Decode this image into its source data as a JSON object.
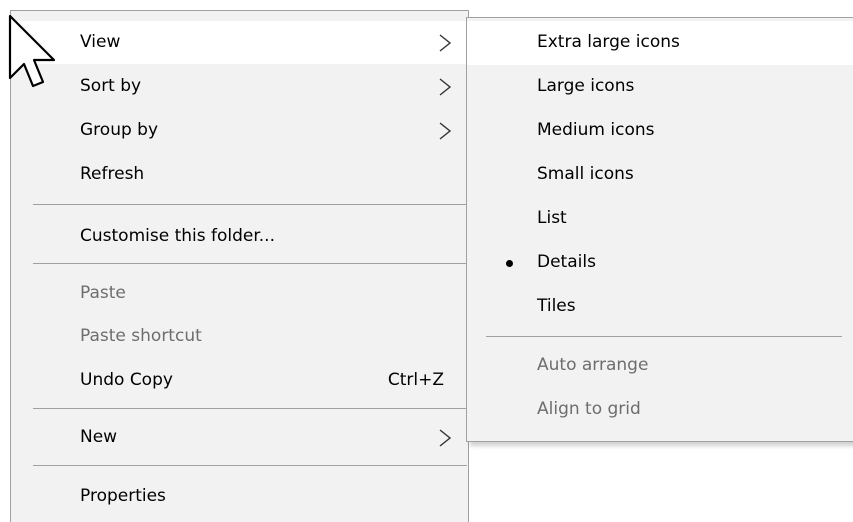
{
  "context_menu": {
    "items": [
      {
        "label": "View",
        "has_submenu": true,
        "highlighted": true
      },
      {
        "label": "Sort by",
        "has_submenu": true
      },
      {
        "label": "Group by",
        "has_submenu": true
      },
      {
        "label": "Refresh"
      },
      {
        "label": "Customise this folder..."
      },
      {
        "label": "Paste",
        "disabled": true
      },
      {
        "label": "Paste shortcut",
        "disabled": true
      },
      {
        "label": "Undo Copy",
        "shortcut": "Ctrl+Z"
      },
      {
        "label": "New",
        "has_submenu": true
      },
      {
        "label": "Properties"
      }
    ]
  },
  "view_submenu": {
    "items": [
      {
        "label": "Extra large icons",
        "highlighted": true
      },
      {
        "label": "Large icons"
      },
      {
        "label": "Medium icons"
      },
      {
        "label": "Small icons"
      },
      {
        "label": "List"
      },
      {
        "label": "Details",
        "selected": true
      },
      {
        "label": "Tiles"
      },
      {
        "label": "Auto arrange",
        "disabled": true
      },
      {
        "label": "Align to grid",
        "disabled": true
      }
    ]
  },
  "colors": {
    "menu_background": "#f2f2f2",
    "highlight_background": "#ffffff",
    "separator": "#a0a0a0",
    "disabled_text": "#6d6d6d"
  },
  "icons": {
    "submenu_arrow": "chevron-right-icon",
    "selected_marker": "bullet-icon",
    "pointer": "mouse-pointer-icon"
  }
}
